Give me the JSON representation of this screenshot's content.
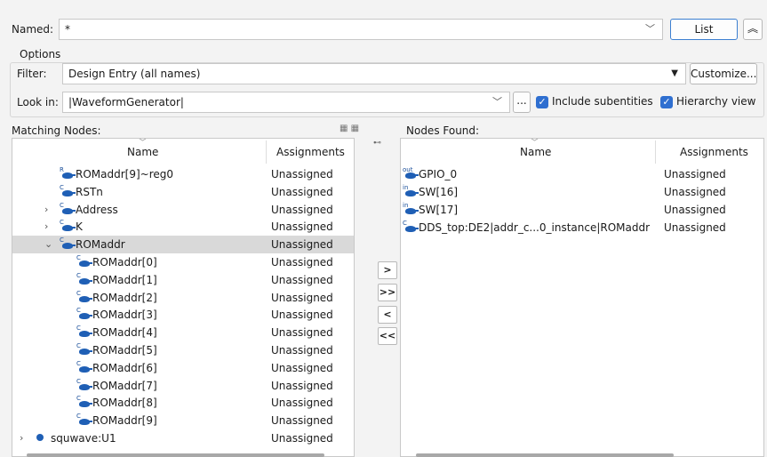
{
  "named": {
    "label": "Named:",
    "value": "*",
    "list_button": "List",
    "collapse_icon": "double-chevron-up-icon"
  },
  "options": {
    "legend": "Options",
    "filter_label": "Filter:",
    "filter_value": "Design Entry (all names)",
    "customize_button": "Customize...",
    "lookin_label": "Look in:",
    "lookin_value": "|WaveformGenerator|",
    "browse_button": "...",
    "include_subentities": "Include subentities",
    "hierarchy_view": "Hierarchy view"
  },
  "matching": {
    "title": "Matching Nodes:",
    "col_name": "Name",
    "col_assign": "Assignments",
    "rows": [
      {
        "name": "ROMaddr[9]~reg0",
        "assign": "Unassigned",
        "icon": "R"
      },
      {
        "name": "RSTn",
        "assign": "Unassigned",
        "icon": "C"
      },
      {
        "name": "Address",
        "assign": "Unassigned",
        "icon": "C",
        "expander": "›"
      },
      {
        "name": "K",
        "assign": "Unassigned",
        "icon": "C",
        "expander": "›"
      },
      {
        "name": "ROMaddr",
        "assign": "Unassigned",
        "icon": "C",
        "expander": "⌄",
        "selected": true
      },
      {
        "name": "ROMaddr[0]",
        "assign": "Unassigned",
        "icon": "C"
      },
      {
        "name": "ROMaddr[1]",
        "assign": "Unassigned",
        "icon": "C"
      },
      {
        "name": "ROMaddr[2]",
        "assign": "Unassigned",
        "icon": "C"
      },
      {
        "name": "ROMaddr[3]",
        "assign": "Unassigned",
        "icon": "C"
      },
      {
        "name": "ROMaddr[4]",
        "assign": "Unassigned",
        "icon": "C"
      },
      {
        "name": "ROMaddr[5]",
        "assign": "Unassigned",
        "icon": "C"
      },
      {
        "name": "ROMaddr[6]",
        "assign": "Unassigned",
        "icon": "C"
      },
      {
        "name": "ROMaddr[7]",
        "assign": "Unassigned",
        "icon": "C"
      },
      {
        "name": "ROMaddr[8]",
        "assign": "Unassigned",
        "icon": "C"
      },
      {
        "name": "ROMaddr[9]",
        "assign": "Unassigned",
        "icon": "C"
      },
      {
        "name": "squwave:U1",
        "assign": "Unassigned",
        "icon": "dot",
        "expander": "›"
      }
    ]
  },
  "move_buttons": [
    ">",
    ">>",
    "<",
    "<<"
  ],
  "found": {
    "title": "Nodes Found:",
    "col_name": "Name",
    "col_assign": "Assignments",
    "rows": [
      {
        "name": "GPIO_0",
        "assign": "Unassigned",
        "icon": "out"
      },
      {
        "name": "SW[16]",
        "assign": "Unassigned",
        "icon": "in"
      },
      {
        "name": "SW[17]",
        "assign": "Unassigned",
        "icon": "in"
      },
      {
        "name": "DDS_top:DE2|addr_c...0_instance|ROMaddr",
        "assign": "Unassigned",
        "icon": "C"
      }
    ]
  }
}
